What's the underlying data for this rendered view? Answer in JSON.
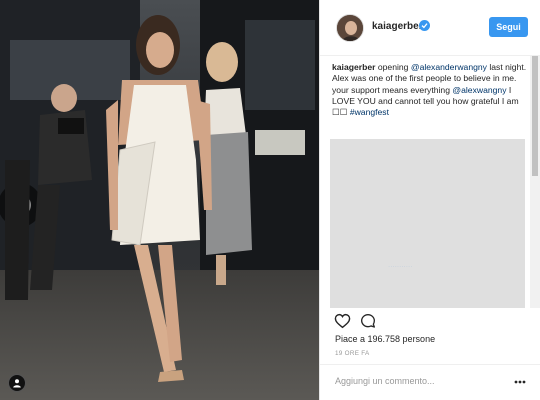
{
  "post": {
    "username": "kaiagerber",
    "follow_label": "Segui",
    "caption": {
      "username": "kaiagerber",
      "t1": " opening ",
      "mention1": "@alexanderwangny",
      "t2": " last night. Alex was one of the first people to believe in me. your support means everything ",
      "mention2": "@alexwangny",
      "t3": " I LOVE YOU and cannot tell you how grateful I am ",
      "emoji": "☐☐",
      "t4": " ",
      "hashtag": "#wangfest"
    },
    "likes": "Piace a 196.758 persone",
    "time": "19 ORE FA",
    "comment_placeholder": "Aggiungi un commento...",
    "media_link": "..........."
  },
  "colors": {
    "accent": "#3897f0",
    "link": "#003569"
  },
  "icons": {
    "verified": "verified-badge-icon",
    "heart": "heart-icon",
    "comment": "comment-icon",
    "more": "more-options-icon",
    "tag": "user-tag-icon"
  }
}
